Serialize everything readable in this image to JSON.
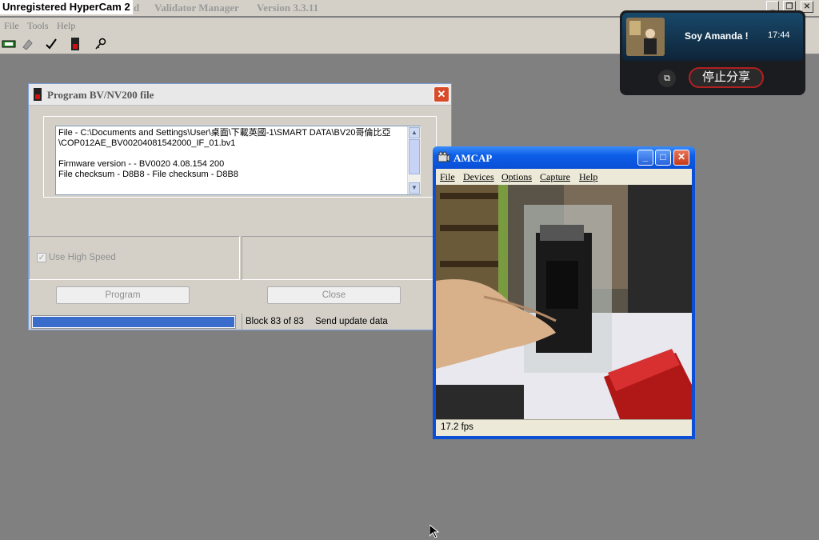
{
  "main_window": {
    "watermark": "Unregistered HyperCam 2",
    "title_fragment": "d",
    "app_name": "Validator Manager",
    "version": "Version 3.3.11",
    "menu": [
      "File",
      "Tools",
      "Help"
    ]
  },
  "program_dialog": {
    "title": "Program BV/NV200 file",
    "close_label": "✕",
    "file_info_lines": [
      "File - C:\\Documents and Settings\\User\\桌面\\下載英國-1\\SMART DATA\\BV20哥倫比亞",
      "\\COP012AE_BV00204081542000_IF_01.bv1",
      "",
      "Firmware version - - BV0020 4.08.154 200",
      "File checksum - D8B8 - File checksum - D8B8"
    ],
    "use_high_speed_label": "Use High Speed",
    "use_high_speed_checked": true,
    "program_button": "Program",
    "close_button": "Close",
    "progress_fraction": 1.0,
    "block_status": "Block 83 of 83",
    "status_message": "Send update data"
  },
  "amcap": {
    "title": "AMCAP",
    "menu": [
      "File",
      "Devices",
      "Options",
      "Capture",
      "Help"
    ],
    "fps": "17.2 fps"
  },
  "notification": {
    "name": "Soy Amanda !",
    "time": "17:44",
    "stop_share_label": "停止分享"
  },
  "colors": {
    "desktop": "#808080",
    "progress_fill": "#3a6ccc",
    "xp_title_blue": "#0a4fd6",
    "close_red": "#d84b2a"
  }
}
